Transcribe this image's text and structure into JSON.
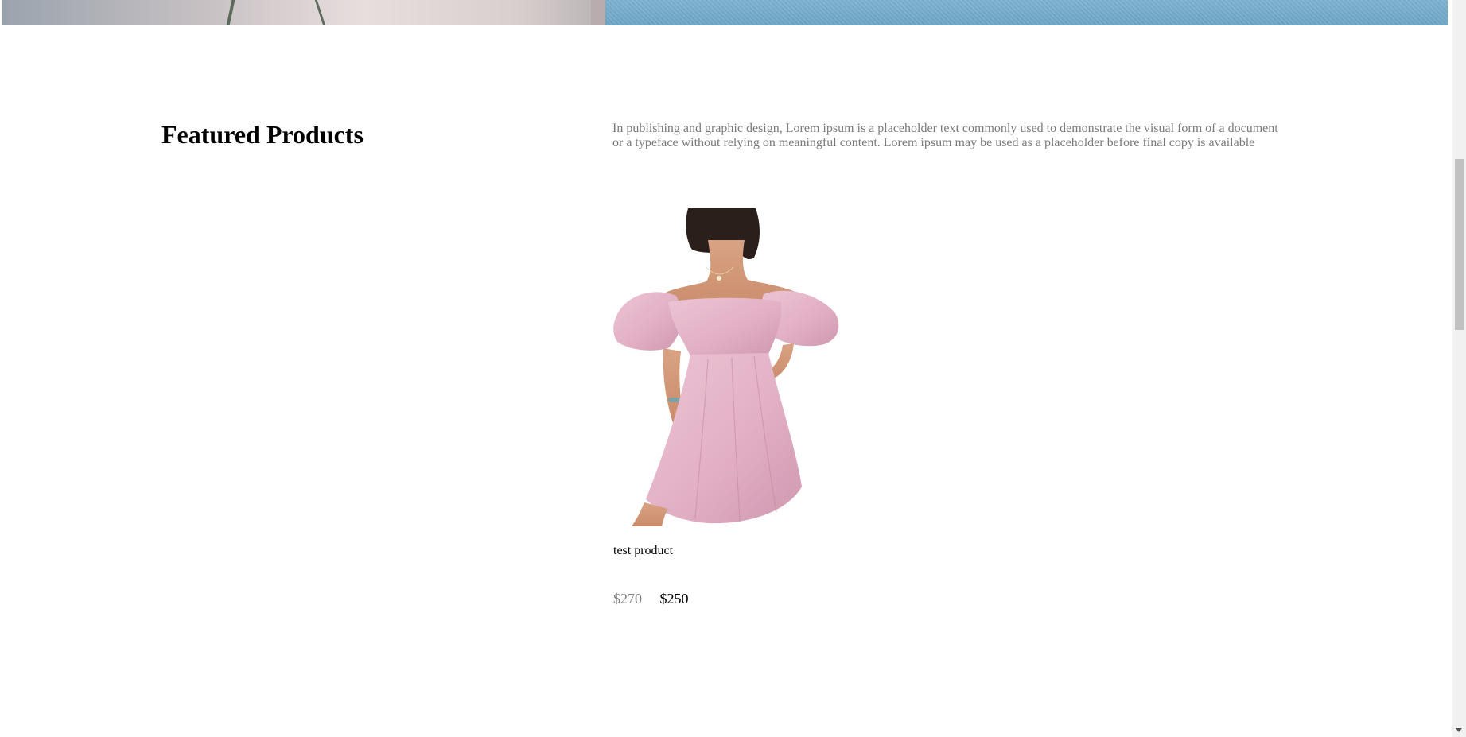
{
  "featured": {
    "title": "Featured Products",
    "description": "In publishing and graphic design, Lorem ipsum is a placeholder text commonly used to demonstrate the visual form of a document or a typeface without relying on meaningful content. Lorem ipsum may be used as a placeholder before final copy is available"
  },
  "products": [
    {
      "name": "test product",
      "old_price": "$270",
      "price": "$250",
      "image_icon": "pink-off-shoulder-dress-photo"
    }
  ],
  "colors": {
    "title_text": "#000000",
    "description_text": "#7a7a7a",
    "old_price_text": "#808080",
    "dress_pink": "#e6b8cb",
    "hero_blue": "#6ea7c7"
  }
}
